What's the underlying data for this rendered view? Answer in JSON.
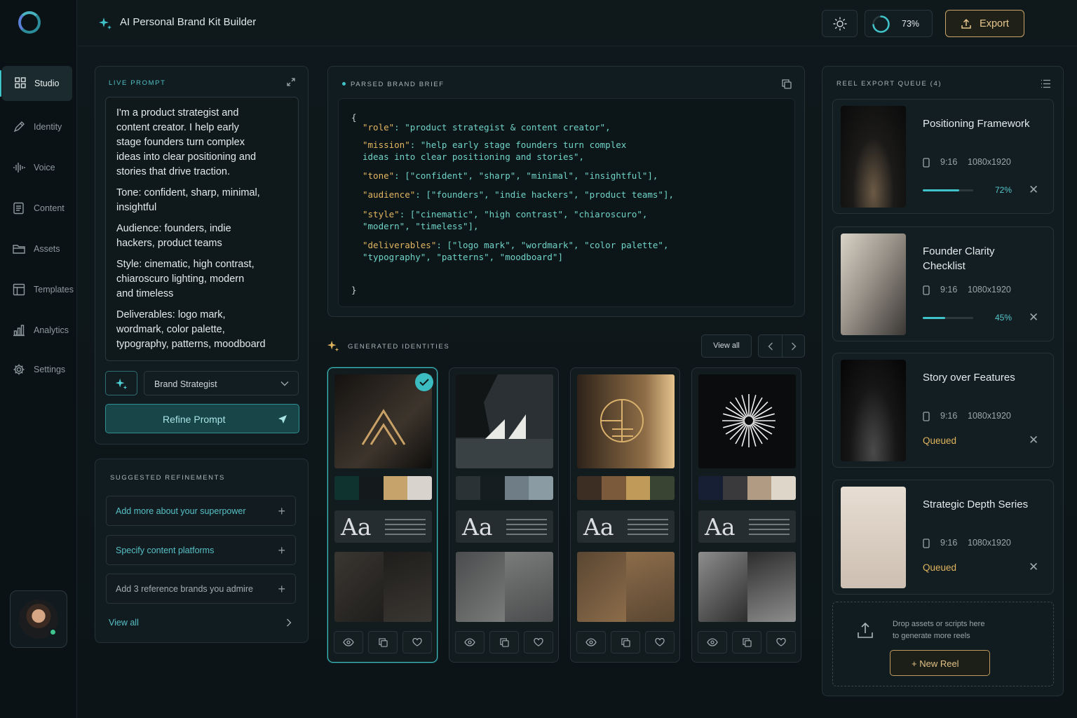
{
  "app": {
    "title": "AI Personal Brand Kit Builder"
  },
  "topbar": {
    "progress_label": "73%",
    "progress": 0.73,
    "export_label": "Export"
  },
  "sidebar": {
    "items": [
      {
        "label": "Studio",
        "icon": "grid-icon",
        "active": true
      },
      {
        "label": "Identity",
        "icon": "pen-icon"
      },
      {
        "label": "Voice",
        "icon": "waveform-icon"
      },
      {
        "label": "Content",
        "icon": "document-icon"
      },
      {
        "label": "Assets",
        "icon": "folder-icon"
      },
      {
        "label": "Templates",
        "icon": "layout-icon"
      },
      {
        "label": "Analytics",
        "icon": "bar-chart-icon"
      },
      {
        "label": "Settings",
        "icon": "gear-icon"
      }
    ]
  },
  "prompt": {
    "caption": "LIVE PROMPT",
    "paragraphs": [
      {
        "lines": [
          "I'm a product strategist and",
          "content creator. I help early",
          "stage founders turn complex",
          "ideas into clear positioning and",
          "stories that drive traction."
        ]
      },
      {
        "lines": [
          "Tone: confident, sharp, minimal,",
          "insightful"
        ]
      },
      {
        "lines": [
          "Audience: founders, indie",
          "hackers, product teams"
        ]
      },
      {
        "lines": [
          "Style: cinematic, high contrast,",
          "chiaroscuro lighting, modern",
          "and timeless"
        ]
      },
      {
        "lines": [
          "Deliverables: logo mark,",
          "wordmark, color palette,",
          "typography, patterns, moodboard"
        ]
      }
    ],
    "persona": "Brand Strategist",
    "refine_label": "Refine Prompt"
  },
  "suggestions": {
    "caption": "SUGGESTED REFINEMENTS",
    "items": [
      "Add more about your superpower",
      "Specify content platforms",
      "Add 3 reference brands you admire"
    ],
    "view_all": "View all"
  },
  "brief": {
    "caption": "PARSED BRAND BRIEF",
    "open": "{",
    "close": "}",
    "lines": [
      {
        "key": "\"role\"",
        "rest": ": \"product strategist & content creator\","
      },
      {
        "key": "\"mission\"",
        "rest": ": \"help early stage founders turn complex"
      },
      {
        "key": "",
        "rest": "ideas into clear positioning and stories\","
      },
      {
        "key": "\"tone\"",
        "rest": ": [\"confident\", \"sharp\", \"minimal\", \"insightful\"],"
      },
      {
        "key": "\"audience\"",
        "rest": ": [\"founders\", \"indie hackers\", \"product teams\"],"
      },
      {
        "key": "\"style\"",
        "rest": ": [\"cinematic\", \"high contrast\", \"chiaroscuro\","
      },
      {
        "key": "",
        "rest": "\"modern\", \"timeless\"],"
      },
      {
        "key": "\"deliverables\"",
        "rest": ": [\"logo mark\", \"wordmark\", \"color palette\","
      },
      {
        "key": "",
        "rest": "\"typography\", \"patterns\", \"moodboard\"]"
      }
    ]
  },
  "identities": {
    "caption": "GENERATED IDENTITIES",
    "view_all": "View all",
    "type_sample": "Aa",
    "cards": [
      {
        "palette": [
          "#0f3430",
          "#141a1b",
          "#c6a36a",
          "#d8d3cc"
        ],
        "selected": true,
        "mood": [
          "#3a3632",
          "#1f1e1c"
        ]
      },
      {
        "palette": [
          "#2b3236",
          "#161d20",
          "#6f7e86",
          "#8a9ba3"
        ],
        "mood": [
          "#4a4c4d",
          "#7a7c7b"
        ]
      },
      {
        "palette": [
          "#3c2e22",
          "#7a5a3a",
          "#c09a58",
          "#394433"
        ],
        "mood": [
          "#5a4632",
          "#8c6d4a"
        ]
      },
      {
        "palette": [
          "#161f33",
          "#3a3a3c",
          "#b19b82",
          "#ddd6c9"
        ],
        "mood": [
          "#8d8d8d",
          "#2d2d2d"
        ]
      }
    ]
  },
  "queue": {
    "caption": "REEL EXPORT QUEUE (4)",
    "items": [
      {
        "title": "Positioning Framework",
        "ratio": "9:16",
        "resolution": "1080x1920",
        "status": "72%",
        "progress": 0.72
      },
      {
        "title": "Founder Clarity Checklist",
        "ratio": "9:16",
        "resolution": "1080x1920",
        "status": "45%",
        "progress": 0.45
      },
      {
        "title": "Story over Features",
        "ratio": "9:16",
        "resolution": "1080x1920",
        "status": "Queued"
      },
      {
        "title": "Strategic Depth Series",
        "ratio": "9:16",
        "resolution": "1080x1920",
        "status": "Queued"
      }
    ],
    "drop_text_1": "Drop assets or scripts here",
    "drop_text_2": "to generate more reels",
    "new_reel": "+ New Reel"
  },
  "colors": {
    "accent": "#3fc3c9",
    "gold": "#e0b45e",
    "bg": "#0d1619"
  }
}
